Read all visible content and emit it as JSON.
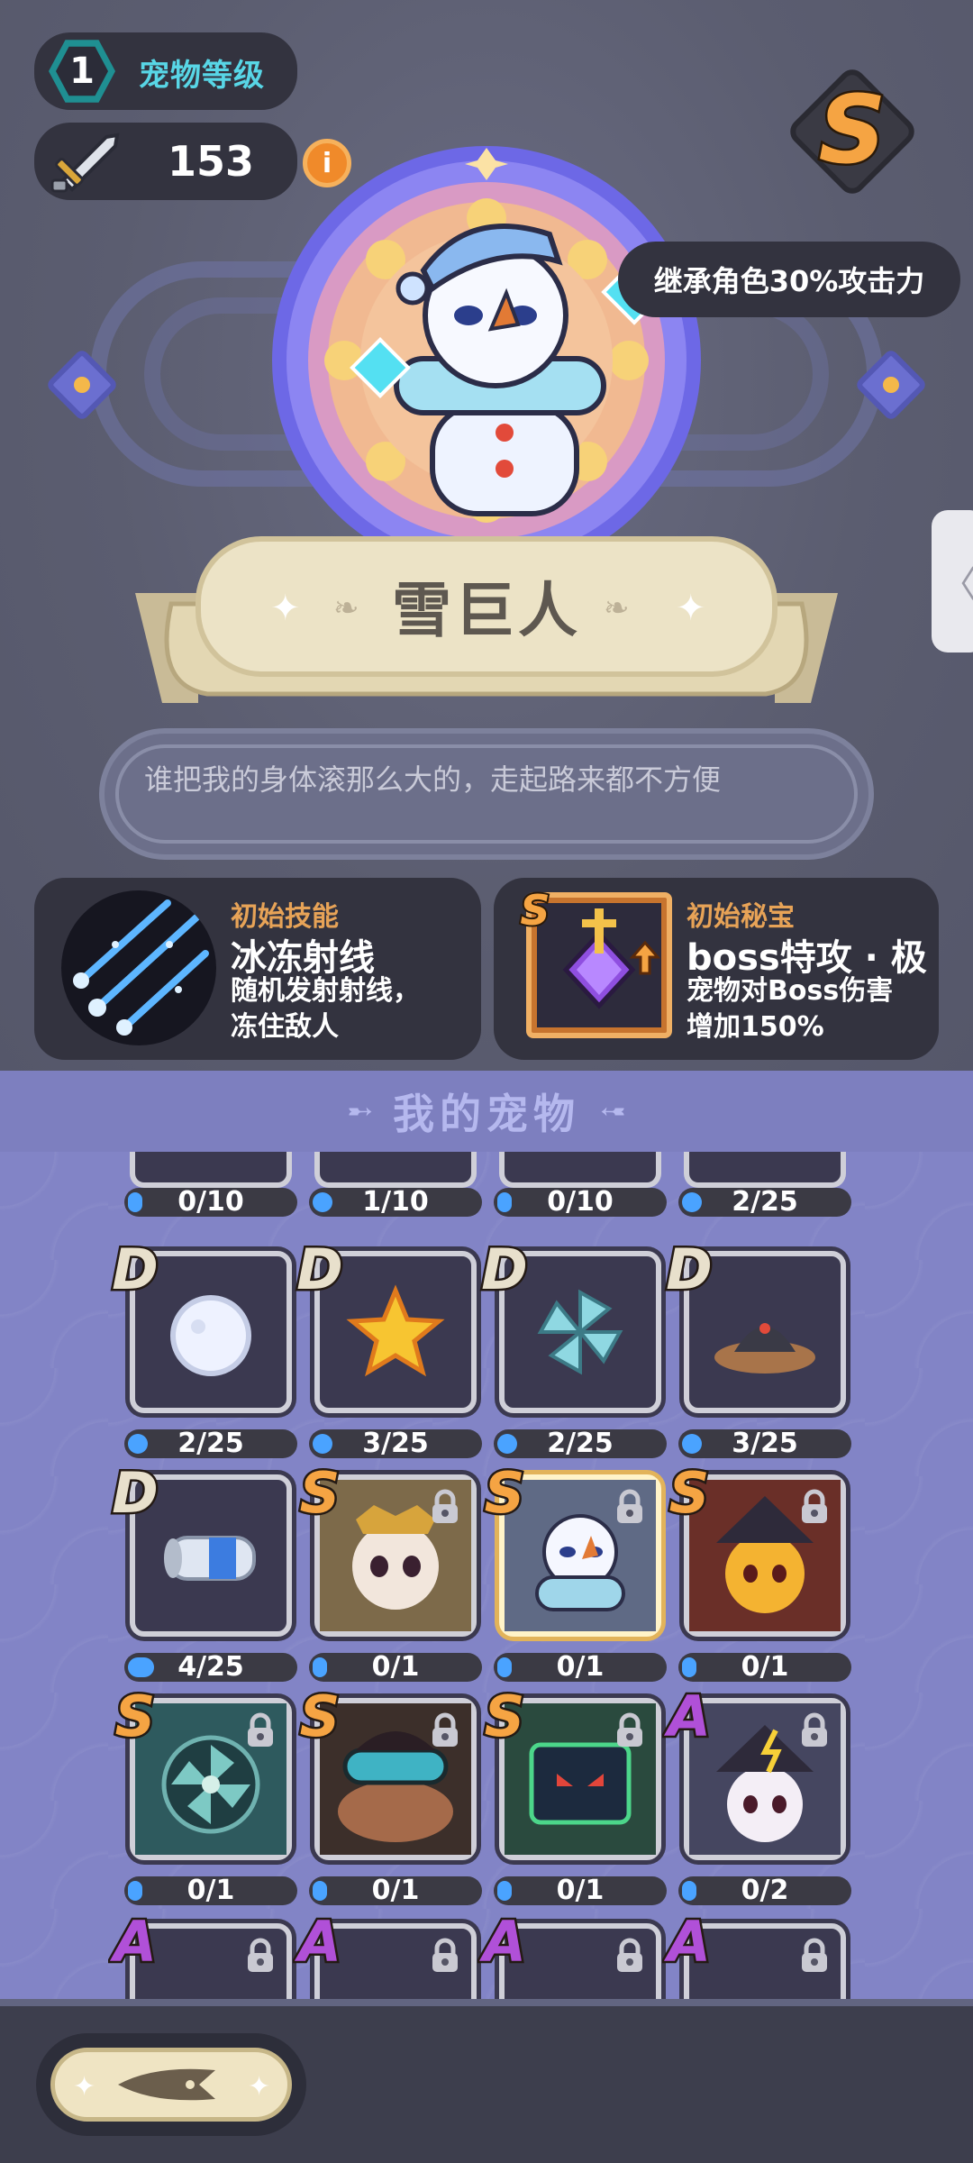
{
  "header": {
    "pet_level": "1",
    "pet_level_label": "宠物等级",
    "power_value": "153",
    "info_icon_label": "i",
    "rank_letter": "S",
    "inherit_text": "继承角色30%攻击力"
  },
  "pet": {
    "name": "雪巨人",
    "description": "谁把我的身体滚那么大的，走起路来都不方便"
  },
  "skill": {
    "kicker": "初始技能",
    "title": "冰冻射线",
    "desc_line1": "随机发射射线，",
    "desc_line2": "冻住敌人"
  },
  "treasure": {
    "kicker": "初始秘宝",
    "rank": "S",
    "title": "boss特攻 · 极",
    "desc_line1": "宠物对Boss伤害",
    "desc_line2": "增加150%"
  },
  "my_pets": {
    "title": "我的宠物",
    "partial_row_counts": [
      "0/10",
      "1/10",
      "0/10",
      "2/25"
    ],
    "partial_row_progress": [
      0,
      0.1,
      0,
      0.08
    ],
    "rows": [
      [
        {
          "rank": "D",
          "count": "2/25",
          "progress": 0.08,
          "icon": "snowball-icon",
          "locked": false
        },
        {
          "rank": "D",
          "count": "3/25",
          "progress": 0.12,
          "icon": "star-icon",
          "locked": false
        },
        {
          "rank": "D",
          "count": "2/25",
          "progress": 0.08,
          "icon": "pinwheel-icon",
          "locked": false
        },
        {
          "rank": "D",
          "count": "3/25",
          "progress": 0.12,
          "icon": "mole-icon",
          "locked": false
        }
      ],
      [
        {
          "rank": "D",
          "count": "4/25",
          "progress": 0.16,
          "icon": "battery-icon",
          "locked": false
        },
        {
          "rank": "S",
          "count": "0/1",
          "progress": 0,
          "icon": "skull-king-icon",
          "locked": true
        },
        {
          "rank": "S",
          "count": "0/1",
          "progress": 0,
          "icon": "snowman-icon",
          "locked": true,
          "selected": true
        },
        {
          "rank": "S",
          "count": "0/1",
          "progress": 0,
          "icon": "fire-witch-icon",
          "locked": true
        }
      ],
      [
        {
          "rank": "S",
          "count": "0/1",
          "progress": 0,
          "icon": "fan-icon",
          "locked": true
        },
        {
          "rank": "S",
          "count": "0/1",
          "progress": 0,
          "icon": "goggles-critter-icon",
          "locked": true
        },
        {
          "rank": "S",
          "count": "0/1",
          "progress": 0,
          "icon": "tv-robot-icon",
          "locked": true
        },
        {
          "rank": "A",
          "count": "0/2",
          "progress": 0,
          "icon": "storm-witch-icon",
          "locked": true
        }
      ]
    ],
    "bottom_ranks": [
      "A",
      "A",
      "A",
      "A"
    ]
  },
  "colors": {
    "rank_S": "#f5a443",
    "rank_A": "#b050d8",
    "rank_D": "#e8e0cc",
    "accent_cyan": "#58d6e6",
    "kicker_orange": "#e7a357"
  }
}
